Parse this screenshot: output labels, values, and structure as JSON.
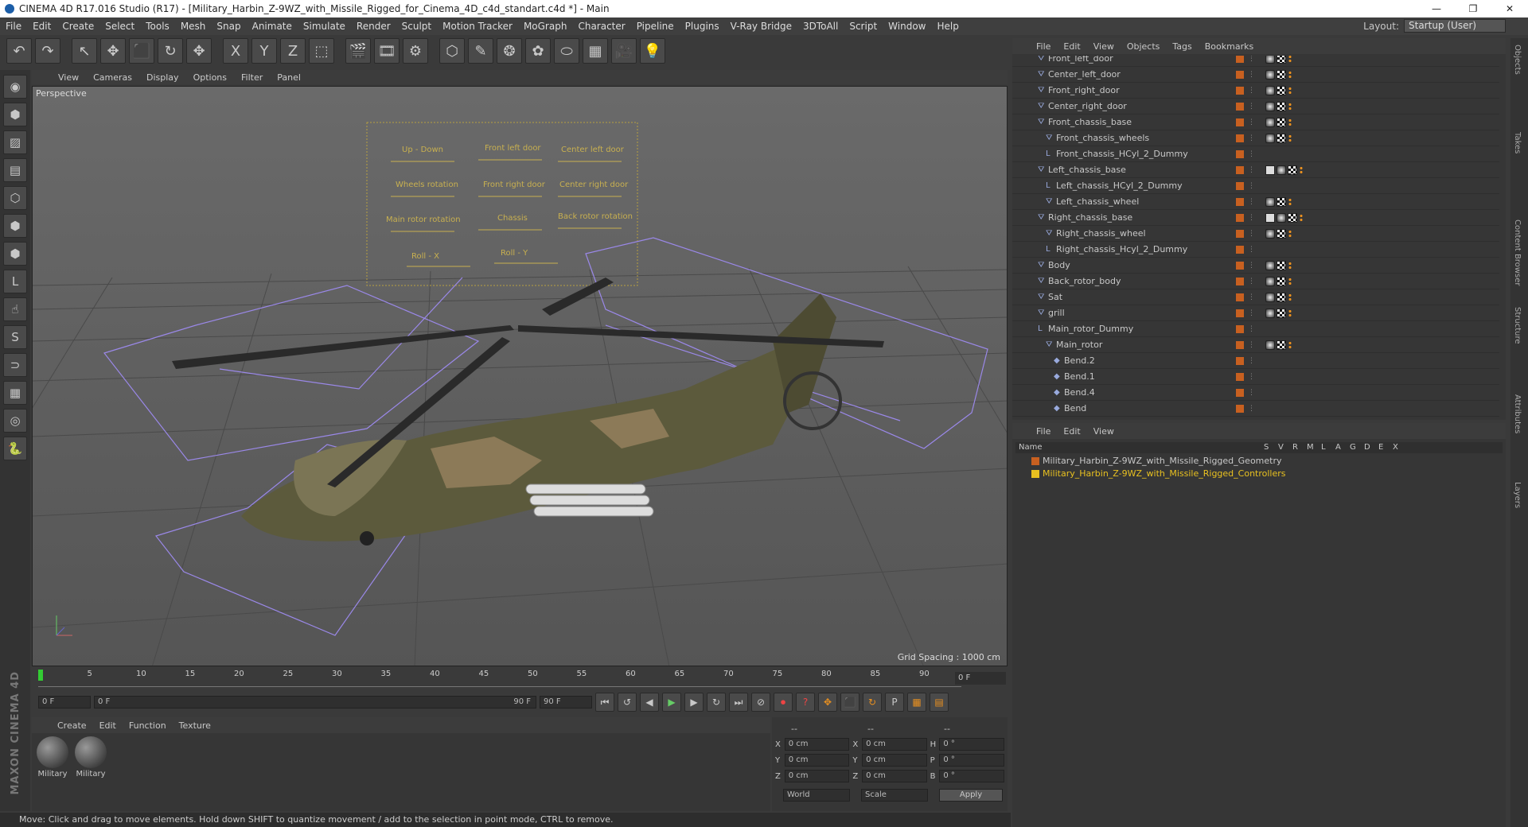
{
  "window": {
    "title": "CINEMA 4D R17.016 Studio (R17) - [Military_Harbin_Z-9WZ_with_Missile_Rigged_for_Cinema_4D_c4d_standart.c4d *] - Main",
    "controls": [
      "—",
      "❐",
      "✕"
    ]
  },
  "menubar": {
    "items": [
      "File",
      "Edit",
      "Create",
      "Select",
      "Tools",
      "Mesh",
      "Snap",
      "Animate",
      "Simulate",
      "Render",
      "Sculpt",
      "Motion Tracker",
      "MoGraph",
      "Character",
      "Pipeline",
      "Plugins",
      "V-Ray Bridge",
      "3DToAll",
      "Script",
      "Window",
      "Help"
    ],
    "layout_label": "Layout:",
    "layout_value": "Startup (User)"
  },
  "toolbar": {
    "icons": [
      "undo-icon",
      "redo-icon",
      "live-select-icon",
      "move-icon",
      "scale-icon",
      "rotate-icon",
      "transform-icon",
      "x-axis-icon",
      "y-axis-icon",
      "z-axis-icon",
      "coordinate-system-icon",
      "render-view-icon",
      "render-picture-viewer-icon",
      "edit-render-settings-icon",
      "cube-icon",
      "pen-icon",
      "subdivision-icon",
      "array-icon",
      "deformer-icon",
      "floor-icon",
      "camera-icon",
      "light-icon"
    ],
    "glyphs": [
      "↶",
      "↷",
      "↖",
      "✥",
      "⬛",
      "↻",
      "✥",
      "X",
      "Y",
      "Z",
      "⬚",
      "🎬",
      "🎞",
      "⚙",
      "⬡",
      "✎",
      "❂",
      "✿",
      "⬭",
      "▦",
      "🎥",
      "💡"
    ]
  },
  "left_toolbar": {
    "icons": [
      "make-editable-icon",
      "model-mode-icon",
      "texture-mode-icon",
      "workplane-mode-icon",
      "points-mode-icon",
      "edges-mode-icon",
      "polygons-mode-icon",
      "axis-icon",
      "tweak-icon",
      "snap-icon",
      "magnet-icon",
      "grid-snap-icon",
      "soft-selection-icon",
      "python-icon"
    ],
    "glyphs": [
      "◉",
      "⬢",
      "▨",
      "▤",
      "⬡",
      "⬢",
      "⬢",
      "L",
      "☝",
      "S",
      "⊃",
      "▦",
      "◎",
      "🐍"
    ],
    "brand": "MAXON CINEMA 4D"
  },
  "viewport": {
    "menu": [
      "View",
      "Cameras",
      "Display",
      "Options",
      "Filter",
      "Panel"
    ],
    "label": "Perspective",
    "grid_spacing": "Grid Spacing : 1000 cm",
    "hud_labels": [
      "Up - Down",
      "Front left door",
      "Center left door",
      "Wheels rotation",
      "Front right door",
      "Center right door",
      "Main rotor rotation",
      "Chassis",
      "Back rotor rotation",
      "Roll - X",
      "Roll - Y"
    ]
  },
  "timeline": {
    "ticks": [
      "0",
      "5",
      "10",
      "15",
      "20",
      "25",
      "30",
      "35",
      "40",
      "45",
      "50",
      "55",
      "60",
      "65",
      "70",
      "75",
      "80",
      "85",
      "90"
    ],
    "current_frame": "0 F"
  },
  "transport": {
    "start": "0 F",
    "range_start": "0 F",
    "range_end": "90 F",
    "end": "90 F"
  },
  "materials": {
    "menu": [
      "Create",
      "Edit",
      "Function",
      "Texture"
    ],
    "items": [
      {
        "name": "Military"
      },
      {
        "name": "Military"
      }
    ]
  },
  "coordinates": {
    "headers": [
      "--",
      "--",
      "--"
    ],
    "rows": [
      {
        "a": "X",
        "av": "0 cm",
        "b": "X",
        "bv": "0 cm",
        "c": "H",
        "cv": "0 °"
      },
      {
        "a": "Y",
        "av": "0 cm",
        "b": "Y",
        "bv": "0 cm",
        "c": "P",
        "cv": "0 °"
      },
      {
        "a": "Z",
        "av": "0 cm",
        "b": "Z",
        "bv": "0 cm",
        "c": "B",
        "cv": "0 °"
      }
    ],
    "space": "World",
    "mode": "Scale",
    "apply": "Apply"
  },
  "status": "Move: Click and drag to move elements. Hold down SHIFT to quantize movement / add to the selection in point mode, CTRL to remove.",
  "objects": {
    "menu": [
      "File",
      "Edit",
      "View",
      "Objects",
      "Tags",
      "Bookmarks"
    ],
    "rows": [
      {
        "name": "Front_left_door",
        "indent": 1,
        "icon": "⛛",
        "tags": "mco"
      },
      {
        "name": "Center_left_door",
        "indent": 1,
        "icon": "⛛",
        "tags": "mco"
      },
      {
        "name": "Front_right_door",
        "indent": 1,
        "icon": "⛛",
        "tags": "mco"
      },
      {
        "name": "Center_right_door",
        "indent": 1,
        "icon": "⛛",
        "tags": "mco"
      },
      {
        "name": "Front_chassis_base",
        "indent": 1,
        "icon": "⛛",
        "tags": "mco"
      },
      {
        "name": "Front_chassis_wheels",
        "indent": 2,
        "icon": "⛛",
        "tags": "mco"
      },
      {
        "name": "Front_chassis_HCyl_2_Dummy",
        "indent": 2,
        "icon": "L",
        "tags": ""
      },
      {
        "name": "Left_chassis_base",
        "indent": 1,
        "icon": "⛛",
        "tags": "xmco"
      },
      {
        "name": "Left_chassis_HCyl_2_Dummy",
        "indent": 2,
        "icon": "L",
        "tags": ""
      },
      {
        "name": "Left_chassis_wheel",
        "indent": 2,
        "icon": "⛛",
        "tags": "mco"
      },
      {
        "name": "Right_chassis_base",
        "indent": 1,
        "icon": "⛛",
        "tags": "xmco"
      },
      {
        "name": "Right_chassis_wheel",
        "indent": 2,
        "icon": "⛛",
        "tags": "mco"
      },
      {
        "name": "Right_chassis_Hcyl_2_Dummy",
        "indent": 2,
        "icon": "L",
        "tags": ""
      },
      {
        "name": "Body",
        "indent": 1,
        "icon": "⛛",
        "tags": "mco"
      },
      {
        "name": "Back_rotor_body",
        "indent": 1,
        "icon": "⛛",
        "tags": "mco"
      },
      {
        "name": "Sat",
        "indent": 1,
        "icon": "⛛",
        "tags": "mco"
      },
      {
        "name": "grill",
        "indent": 1,
        "icon": "⛛",
        "tags": "mco"
      },
      {
        "name": "Main_rotor_Dummy",
        "indent": 1,
        "icon": "L",
        "tags": ""
      },
      {
        "name": "Main_rotor",
        "indent": 2,
        "icon": "⛛",
        "tags": "mco"
      },
      {
        "name": "Bend.2",
        "indent": 3,
        "icon": "◆",
        "tags": ""
      },
      {
        "name": "Bend.1",
        "indent": 3,
        "icon": "◆",
        "tags": ""
      },
      {
        "name": "Bend.4",
        "indent": 3,
        "icon": "◆",
        "tags": ""
      },
      {
        "name": "Bend",
        "indent": 3,
        "icon": "◆",
        "tags": ""
      }
    ]
  },
  "layers": {
    "menu": [
      "File",
      "Edit",
      "View"
    ],
    "columns": [
      "Name",
      "S",
      "V",
      "R",
      "M",
      "L",
      "A",
      "G",
      "D",
      "E",
      "X"
    ],
    "items": [
      {
        "name": "Military_Harbin_Z-9WZ_with_Missile_Rigged_Geometry",
        "color": "#c86020"
      },
      {
        "name": "Military_Harbin_Z-9WZ_with_Missile_Rigged_Controllers",
        "color": "#e8c020"
      }
    ]
  },
  "right_tabs": [
    "Objects",
    "Takes",
    "Content Browser",
    "Structure",
    "Attributes",
    "Layers"
  ],
  "colors": {
    "accent": "#e8c020",
    "selection": "#c86020"
  }
}
